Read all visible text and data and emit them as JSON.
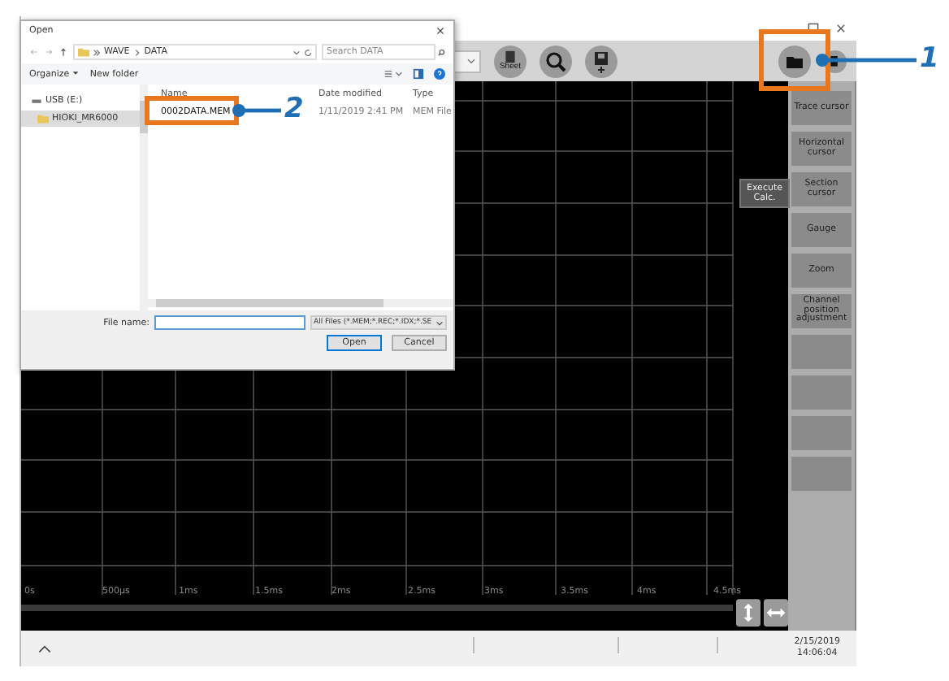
{
  "toolbar": {
    "sheet_label": "Sheet"
  },
  "side_buttons": [
    "Trace cursor",
    "Horizontal cursor",
    "Section cursor",
    "Gauge",
    "Zoom",
    "Channel position adjustment"
  ],
  "plot": {
    "execute_button": "Execute Calc.",
    "x_labels": [
      "0s",
      "500µs",
      "1ms",
      "1.5ms",
      "2ms",
      "2.5ms",
      "3ms",
      "3.5ms",
      "4ms",
      "4.5ms"
    ]
  },
  "status_bar": {
    "date": "2/15/2019",
    "time": "14:06:04"
  },
  "dialog": {
    "title": "Open",
    "path": [
      "WAVE",
      "DATA"
    ],
    "search": {
      "placeholder": "Search DATA"
    },
    "organize": "Organize",
    "new_folder": "New folder",
    "nav": [
      {
        "label": "USB (E:)",
        "kind": "drive",
        "selected": false
      },
      {
        "label": "HIOKI_MR6000",
        "kind": "folder",
        "selected": true
      }
    ],
    "columns": [
      "Name",
      "Date modified",
      "Type"
    ],
    "files": [
      {
        "name": "0002DATA.MEM",
        "date": "1/11/2019 2:41 PM",
        "type": "MEM File"
      }
    ],
    "file_name_label": "File name:",
    "filter": "All Files (*.MEM;*.REC;*.IDX;*.SE",
    "buttons": [
      "Open",
      "Cancel"
    ]
  },
  "callouts": [
    {
      "number": "1"
    },
    {
      "number": "2"
    }
  ]
}
